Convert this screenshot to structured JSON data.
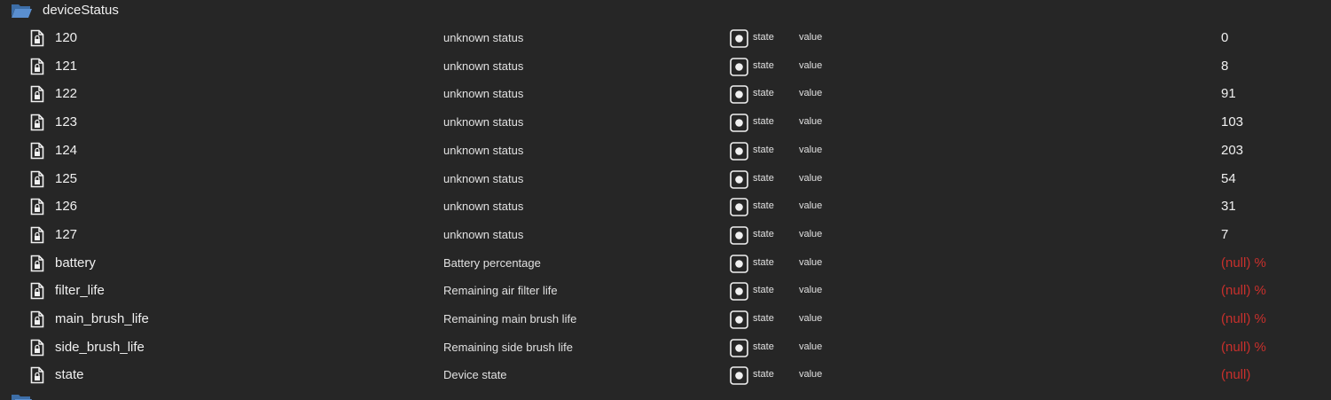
{
  "folder": {
    "name": "deviceStatus",
    "icon": "folder-open-icon",
    "color": "#4a7fc1"
  },
  "columns": {
    "role": "state",
    "type": "value"
  },
  "rows": [
    {
      "name": "120",
      "desc": "unknown status",
      "role": "state",
      "type": "value",
      "value": "0",
      "is_null": false
    },
    {
      "name": "121",
      "desc": "unknown status",
      "role": "state",
      "type": "value",
      "value": "8",
      "is_null": false
    },
    {
      "name": "122",
      "desc": "unknown status",
      "role": "state",
      "type": "value",
      "value": "91",
      "is_null": false
    },
    {
      "name": "123",
      "desc": "unknown status",
      "role": "state",
      "type": "value",
      "value": "103",
      "is_null": false
    },
    {
      "name": "124",
      "desc": "unknown status",
      "role": "state",
      "type": "value",
      "value": "203",
      "is_null": false
    },
    {
      "name": "125",
      "desc": "unknown status",
      "role": "state",
      "type": "value",
      "value": "54",
      "is_null": false
    },
    {
      "name": "126",
      "desc": "unknown status",
      "role": "state",
      "type": "value",
      "value": "31",
      "is_null": false
    },
    {
      "name": "127",
      "desc": "unknown status",
      "role": "state",
      "type": "value",
      "value": "7",
      "is_null": false
    },
    {
      "name": "battery",
      "desc": "Battery percentage",
      "role": "state",
      "type": "value",
      "value": "(null) %",
      "is_null": true
    },
    {
      "name": "filter_life",
      "desc": "Remaining air filter life",
      "role": "state",
      "type": "value",
      "value": "(null) %",
      "is_null": true
    },
    {
      "name": "main_brush_life",
      "desc": "Remaining main brush life",
      "role": "state",
      "type": "value",
      "value": "(null) %",
      "is_null": true
    },
    {
      "name": "side_brush_life",
      "desc": "Remaining side brush life",
      "role": "state",
      "type": "value",
      "value": "(null) %",
      "is_null": true
    },
    {
      "name": "state",
      "desc": "Device state",
      "role": "state",
      "type": "value",
      "value": "(null)",
      "is_null": true
    }
  ],
  "colors": {
    "background": "#262626",
    "null_value": "#c8302c",
    "folder": "#4a7fc1"
  }
}
